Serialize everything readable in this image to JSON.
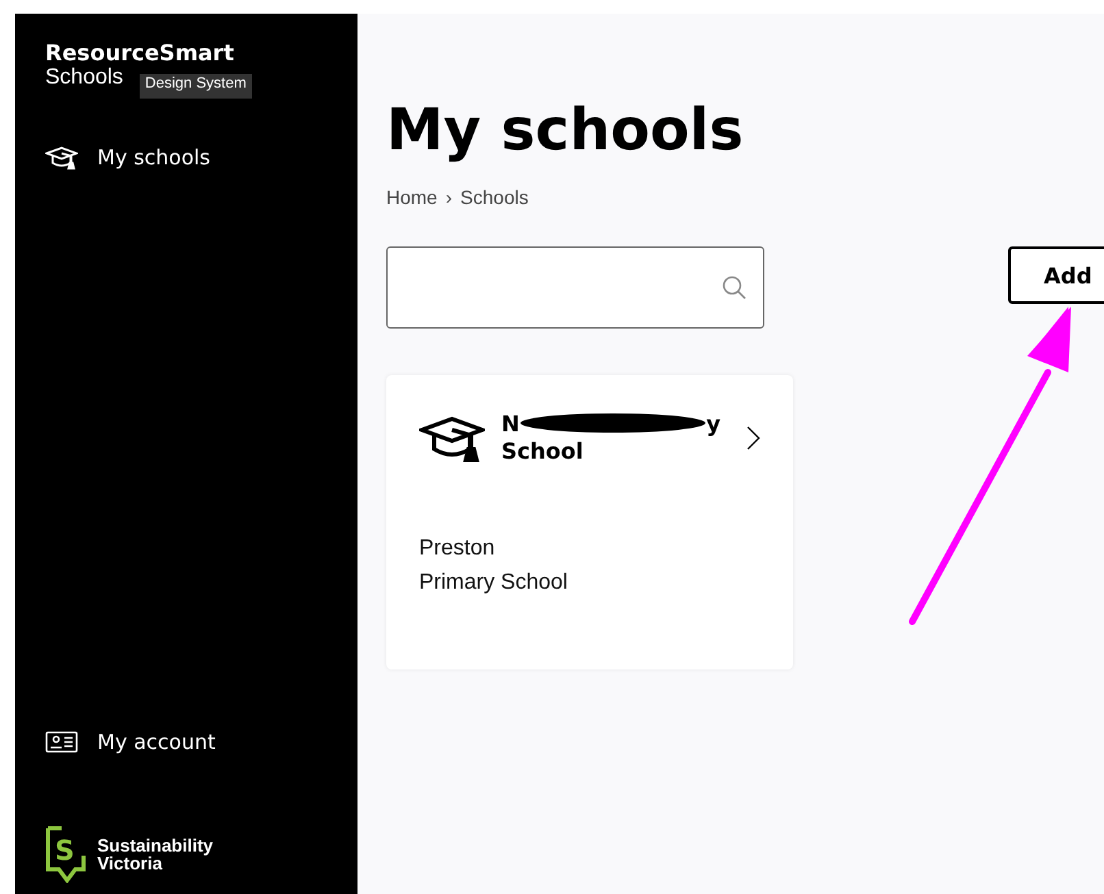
{
  "sidebar": {
    "brand": {
      "name": "ResourceSmart",
      "product": "Schools",
      "tag": "Design System"
    },
    "nav_top": [
      {
        "label": "My schools",
        "kind": "schools"
      }
    ],
    "nav_bottom": [
      {
        "label": "My account",
        "kind": "account"
      }
    ],
    "footer_logo": {
      "line1": "Sustainability",
      "line2": "Victoria",
      "letter": "S"
    }
  },
  "main": {
    "title": "My schools",
    "breadcrumb": [
      {
        "label": "Home"
      },
      {
        "label": "Schools"
      }
    ],
    "breadcrumb_separator": "›",
    "add_button": {
      "label": "Add"
    },
    "cards": [
      {
        "title_start": "N",
        "title_end": "y",
        "title_line2": "School",
        "redacted": true,
        "suburb": "Preston",
        "type": "Primary School"
      }
    ]
  },
  "annotation": {
    "kind": "arrow",
    "color": "#ff00ff"
  }
}
